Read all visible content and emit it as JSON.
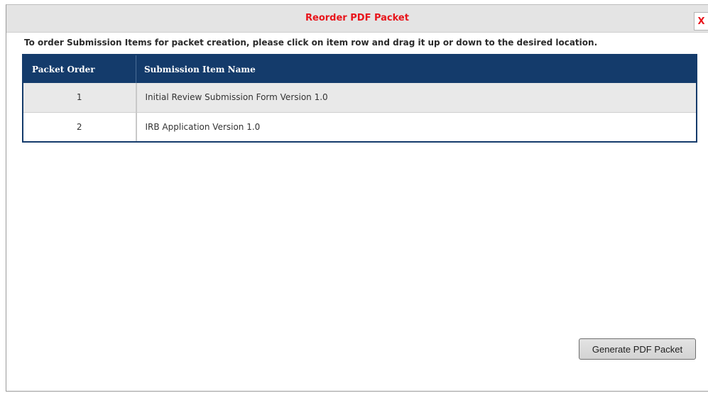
{
  "dialog": {
    "title": "Reorder PDF Packet",
    "close_label": "X",
    "instructions": "To order Submission Items for packet creation, please click on item row and drag it up or down to the desired location."
  },
  "table": {
    "headers": {
      "order": "Packet Order",
      "name": "Submission Item Name"
    },
    "rows": [
      {
        "order": "1",
        "name": "Initial Review Submission Form Version 1.0"
      },
      {
        "order": "2",
        "name": "IRB Application Version 1.0"
      }
    ]
  },
  "actions": {
    "generate_label": "Generate PDF Packet"
  },
  "colors": {
    "title_red": "#e8141b",
    "header_navy": "#143b6b"
  }
}
